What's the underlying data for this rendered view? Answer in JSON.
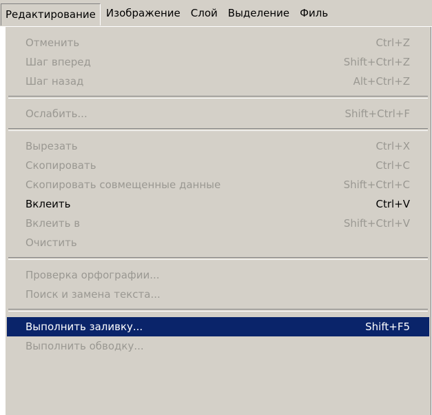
{
  "menubar": {
    "items": [
      "Редактирование",
      "Изображение",
      "Слой",
      "Выделение",
      "Филь"
    ]
  },
  "menu": {
    "groups": [
      [
        {
          "label": "Отменить",
          "shortcut": "Ctrl+Z",
          "enabled": false
        },
        {
          "label": "Шаг вперед",
          "shortcut": "Shift+Ctrl+Z",
          "enabled": false
        },
        {
          "label": "Шаг назад",
          "shortcut": "Alt+Ctrl+Z",
          "enabled": false
        }
      ],
      [
        {
          "label": "Ослабить...",
          "shortcut": "Shift+Ctrl+F",
          "enabled": false
        }
      ],
      [
        {
          "label": "Вырезать",
          "shortcut": "Ctrl+X",
          "enabled": false
        },
        {
          "label": "Скопировать",
          "shortcut": "Ctrl+C",
          "enabled": false
        },
        {
          "label": "Скопировать совмещенные данные",
          "shortcut": "Shift+Ctrl+C",
          "enabled": false
        },
        {
          "label": "Вклеить",
          "shortcut": "Ctrl+V",
          "enabled": true
        },
        {
          "label": "Вклеить в",
          "shortcut": "Shift+Ctrl+V",
          "enabled": false
        },
        {
          "label": "Очистить",
          "shortcut": "",
          "enabled": false
        }
      ],
      [
        {
          "label": "Проверка орфографии...",
          "shortcut": "",
          "enabled": false
        },
        {
          "label": "Поиск и замена текста...",
          "shortcut": "",
          "enabled": false
        }
      ],
      [
        {
          "label": "Выполнить заливку...",
          "shortcut": "Shift+F5",
          "enabled": true,
          "highlighted": true
        },
        {
          "label": "Выполнить обводку...",
          "shortcut": "",
          "enabled": false
        }
      ]
    ]
  }
}
